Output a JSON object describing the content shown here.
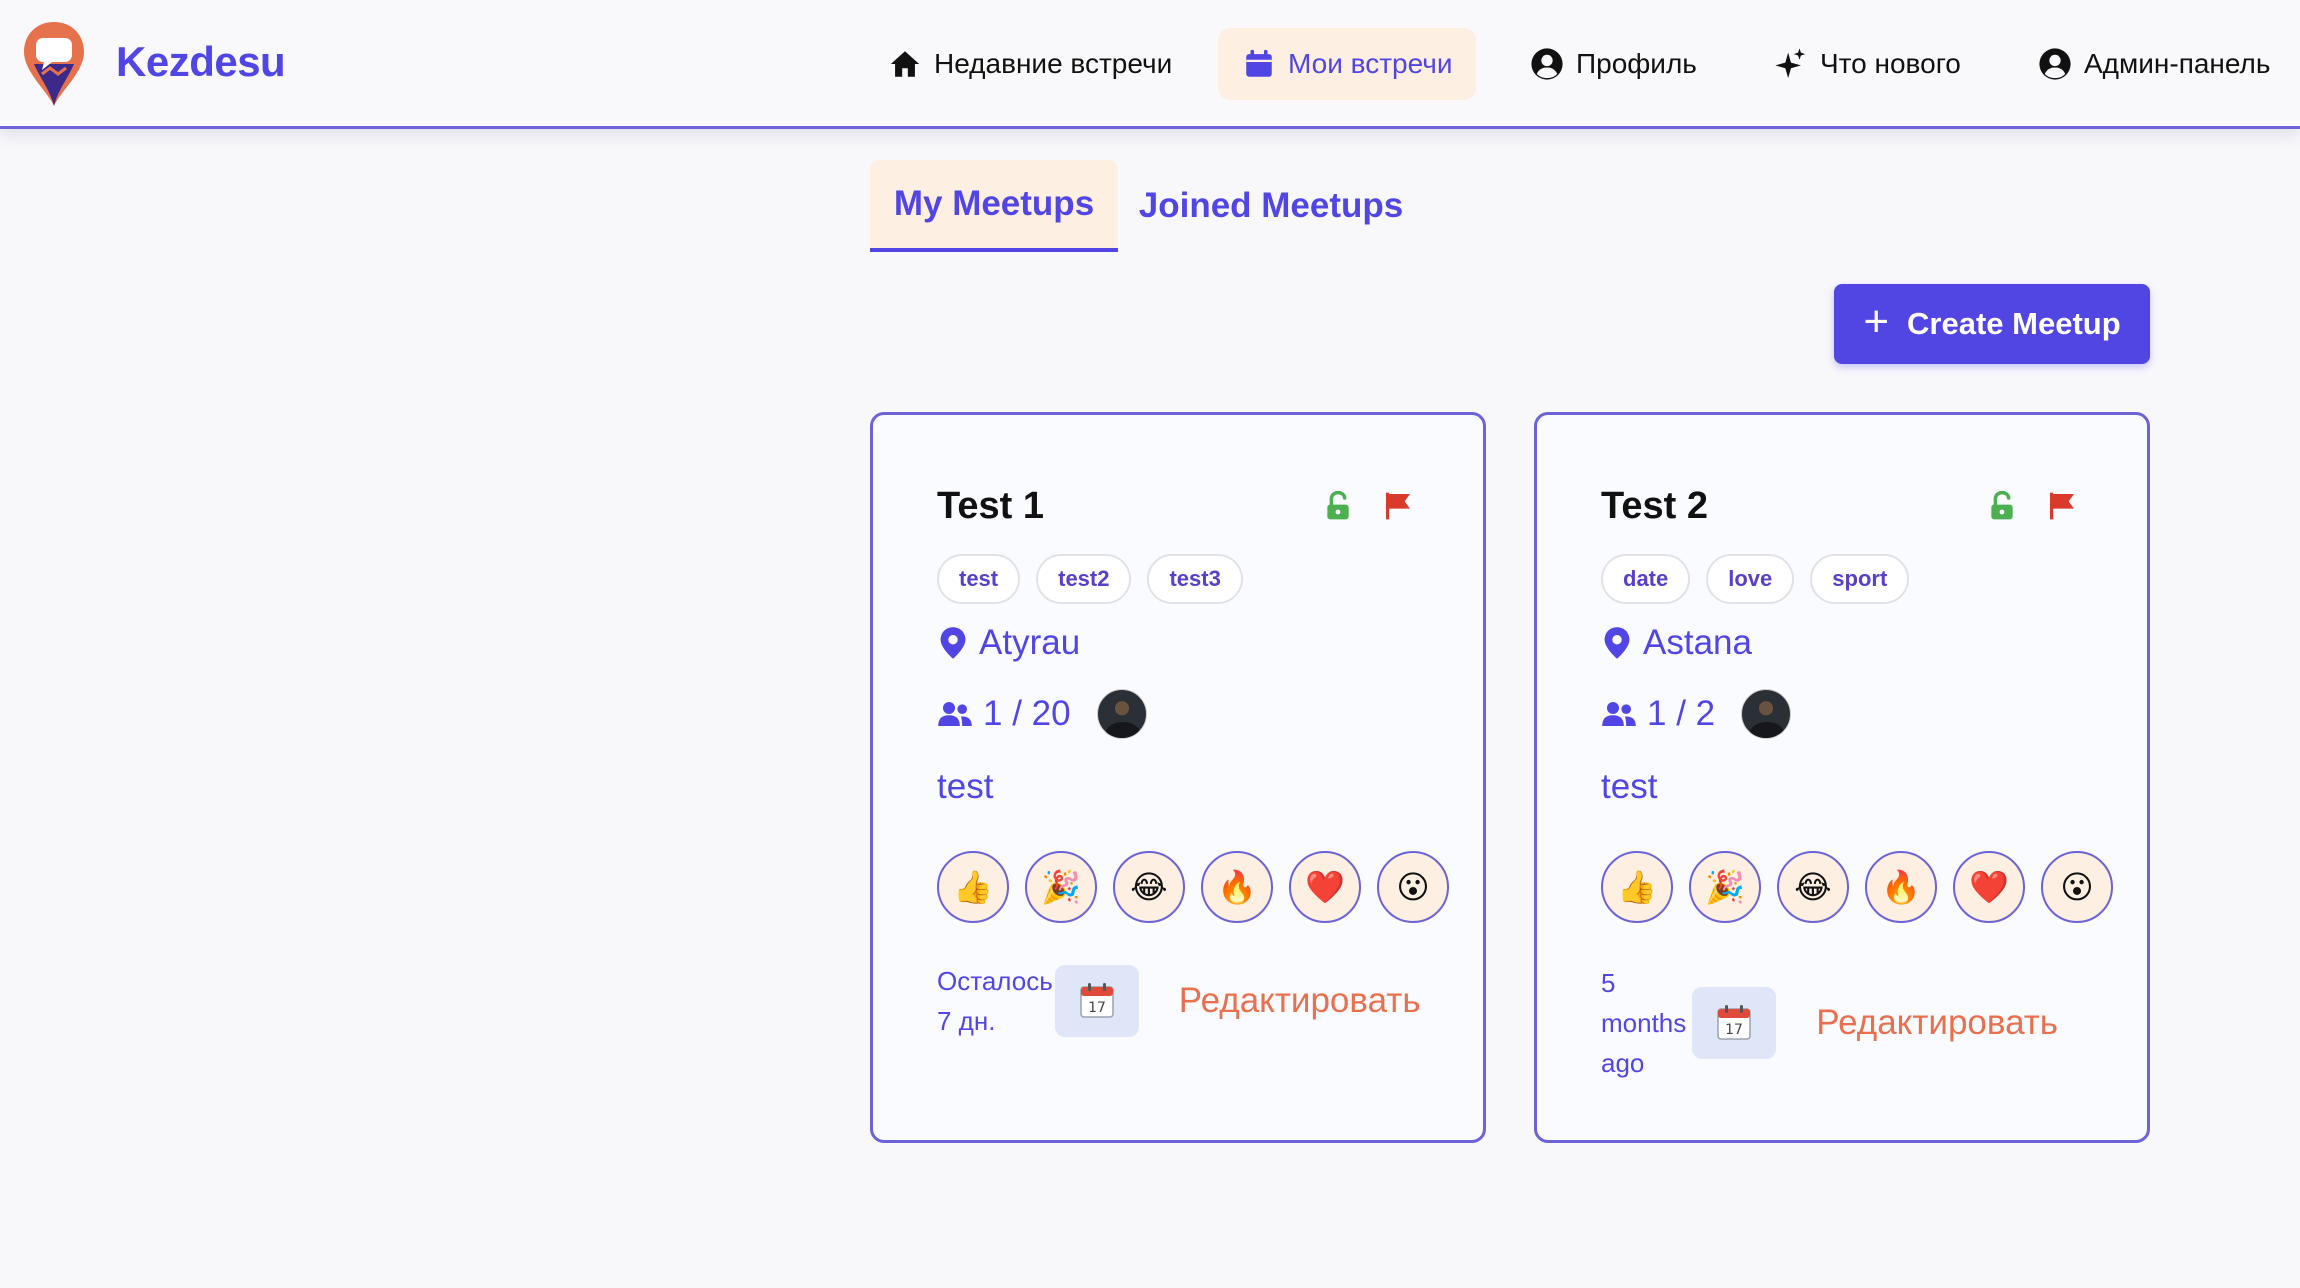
{
  "header": {
    "brand": "Kezdesu",
    "nav": [
      {
        "label": "Недавние встречи",
        "icon": "home-icon"
      },
      {
        "label": "Мои встречи",
        "icon": "calendar-icon",
        "active": true
      },
      {
        "label": "Профиль",
        "icon": "user-circle-icon"
      },
      {
        "label": "Что нового",
        "icon": "sparkles-icon"
      },
      {
        "label": "Админ-панель",
        "icon": "user-circle-icon"
      }
    ]
  },
  "tabs": [
    {
      "label": "My Meetups",
      "active": true
    },
    {
      "label": "Joined Meetups",
      "active": false
    }
  ],
  "create_button": {
    "label": "Create Meetup",
    "icon": "plus-icon"
  },
  "meetups": [
    {
      "title": "Test 1",
      "tags": [
        "test",
        "test2",
        "test3"
      ],
      "location": "Atyrau",
      "participants": "1 / 20",
      "description": "test",
      "reactions": [
        "👍",
        "🎉",
        "😂",
        "🔥",
        "❤️",
        "😮"
      ],
      "time_left": [
        "Осталось",
        "7 дн."
      ],
      "edit_label": "Редактировать"
    },
    {
      "title": "Test 2",
      "tags": [
        "date",
        "love",
        "sport"
      ],
      "location": "Astana",
      "participants": "1 / 2",
      "description": "test",
      "reactions": [
        "👍",
        "🎉",
        "😂",
        "🔥",
        "❤️",
        "😮"
      ],
      "time_left": [
        "5",
        "months",
        "ago"
      ],
      "edit_label": "Редактировать"
    }
  ],
  "colors": {
    "accent": "#5146e4",
    "active_bg": "#fdefe2",
    "edit": "#e8704e",
    "lock": "#4caf50",
    "flag": "#d93a2b"
  }
}
